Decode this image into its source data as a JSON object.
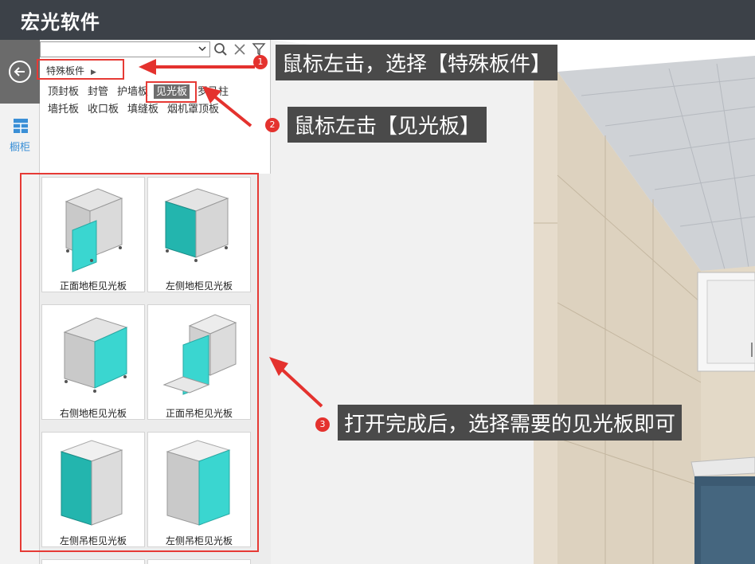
{
  "app": {
    "title": "宏光软件"
  },
  "rail": {
    "category_label": "橱柜"
  },
  "toolbar": {
    "search_value": ""
  },
  "catalog": {
    "breadcrumb": "特殊板件",
    "subcategories": [
      "顶封板",
      "封管",
      "护墙板",
      "见光板",
      "罗马柱",
      "墙托板",
      "收口板",
      "填缝板",
      "烟机罩顶板"
    ],
    "active_subcategory": "见光板",
    "items": [
      {
        "label": "正面地柜见光板"
      },
      {
        "label": "左侧地柜见光板"
      },
      {
        "label": "右侧地柜见光板"
      },
      {
        "label": "正面吊柜见光板"
      },
      {
        "label": "左侧吊柜见光板"
      },
      {
        "label": "左侧吊柜见光板"
      }
    ]
  },
  "annotations": [
    {
      "number": "1",
      "text": "鼠标左击，选择【特殊板件】"
    },
    {
      "number": "2",
      "text": "鼠标左击【见光板】"
    },
    {
      "number": "3",
      "text": "打开完成后，选择需要的见光板即可"
    }
  ],
  "colors": {
    "accent_teal": "#3ad6d0",
    "annotation_red": "#e4322e",
    "titlebar": "#3c4148"
  }
}
